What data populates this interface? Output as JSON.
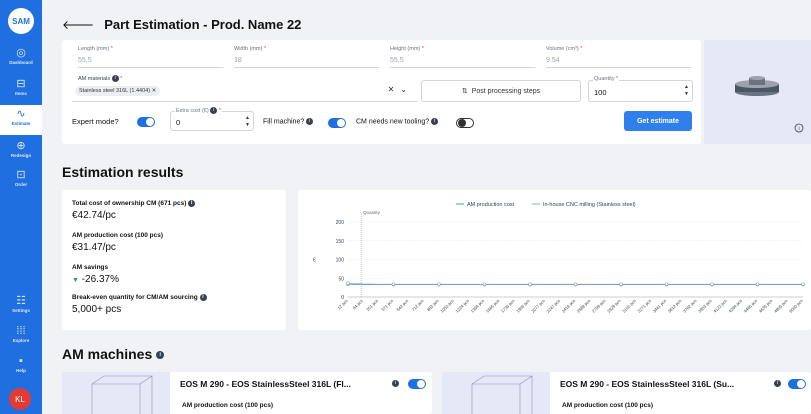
{
  "sidebar": {
    "logo": "SAM",
    "items": [
      {
        "label": "Dashboard",
        "icon": "◎",
        "icon_name": "dashboard-icon"
      },
      {
        "label": "Items",
        "icon": "⊟",
        "icon_name": "items-icon"
      },
      {
        "label": "Estimate",
        "icon": "∿",
        "icon_name": "estimate-icon"
      },
      {
        "label": "Redesign",
        "icon": "⊕",
        "icon_name": "redesign-icon"
      },
      {
        "label": "Order",
        "icon": "⊡",
        "icon_name": "order-icon"
      }
    ],
    "bottom_items": [
      {
        "label": "Settings",
        "icon": "☷",
        "icon_name": "settings-icon"
      },
      {
        "label": "Explore",
        "icon": "⁞⁞⁞",
        "icon_name": "explore-icon"
      },
      {
        "label": "Help",
        "icon": "▪",
        "icon_name": "help-icon"
      }
    ],
    "avatar": "KL"
  },
  "header": {
    "back_icon": "🡐",
    "title": "Part Estimation - Prod. Name 22"
  },
  "form": {
    "length": {
      "label": "Length (mm)",
      "value": "55.5"
    },
    "width": {
      "label": "Width (mm)",
      "value": "18"
    },
    "height": {
      "label": "Height (mm)",
      "value": "55.5"
    },
    "volume": {
      "label": "Volume (cm³)",
      "value": "9.54"
    },
    "materials": {
      "label": "AM materials",
      "chip": "Stainless steel 316L (1.4404)",
      "clear": "✕",
      "chevron": "⌄"
    },
    "post_processing": "Post processing steps",
    "post_icon": "⇅",
    "quantity": {
      "label": "Quantity",
      "value": "100"
    },
    "expert_mode": "Expert mode?",
    "extra_cost": {
      "label": "Extra cost (€)",
      "value": "0"
    },
    "fill_machine": "Fill machine?",
    "new_tooling": "CM needs new tooling?",
    "get_estimate": "Get estimate",
    "required_mark": "*",
    "info_mark": "i",
    "spin_up": "▲",
    "spin_down": "▼"
  },
  "results": {
    "heading": "Estimation results",
    "tco_label": "Total cost of ownership CM (671 pcs)",
    "tco_value": "€42.74/pc",
    "am_cost_label": "AM production cost (100 pcs)",
    "am_cost_value": "€31.47/pc",
    "savings_label": "AM savings",
    "savings_value": "-26.37%",
    "savings_arrow": "▼",
    "breakeven_label": "Break-even quantity for CM/AM sourcing",
    "breakeven_value": "5,000+ pcs"
  },
  "chart_data": {
    "type": "line",
    "legend": [
      "AM production cost",
      "In-house CNC milling (Stainless steel)"
    ],
    "legend_placement": "top",
    "ylabel": "€",
    "ylim": [
      0,
      200
    ],
    "yticks": [
      0,
      50,
      100,
      150,
      200
    ],
    "marker_label": "Quantity",
    "x": [
      "12 pcs",
      "94 pcs",
      "201 pcs",
      "371 pcs",
      "542 pcs",
      "712 pcs",
      "883 pcs",
      "1053 pcs",
      "1224 pcs",
      "1394 pcs",
      "1565 pcs",
      "1736 pcs",
      "1906 pcs",
      "2077 pcs",
      "2247 pcs",
      "2418 pcs",
      "2588 pcs",
      "2759 pcs",
      "2929 pcs",
      "3100 pcs",
      "3271 pcs",
      "3441 pcs",
      "3612 pcs",
      "3782 pcs",
      "3953 pcs",
      "4123 pcs",
      "4294 pcs",
      "4465 pcs",
      "4635 pcs",
      "4806 pcs",
      "5000 pcs"
    ],
    "series": [
      {
        "name": "AM production cost",
        "values": [
          34,
          33,
          33,
          33,
          33,
          33,
          33,
          33,
          33,
          33,
          33,
          33,
          33,
          33,
          33,
          33,
          33,
          33,
          33,
          33,
          33,
          33,
          33,
          33,
          33,
          33,
          33,
          33,
          33,
          33,
          33
        ]
      },
      {
        "name": "In-house CNC milling (Stainless steel)",
        "values": [
          37,
          35,
          34,
          34,
          34,
          34,
          34,
          34,
          34,
          34,
          34,
          34,
          34,
          34,
          34,
          34,
          34,
          34,
          34,
          34,
          34,
          34,
          34,
          34,
          34,
          34,
          34,
          34,
          34,
          34,
          34
        ]
      }
    ],
    "colors": {
      "am": "#4a90e2",
      "cnc": "#9aa7b8"
    }
  },
  "machines": {
    "heading": "AM machines",
    "cards": [
      {
        "title": "EOS M 290 - EOS StainlessSteel 316L (Fl...",
        "sub": "AM production cost (100 pcs)"
      },
      {
        "title": "EOS M 290 - EOS StainlessSteel 316L (Su...",
        "sub": "AM production cost (100 pcs)"
      }
    ]
  }
}
